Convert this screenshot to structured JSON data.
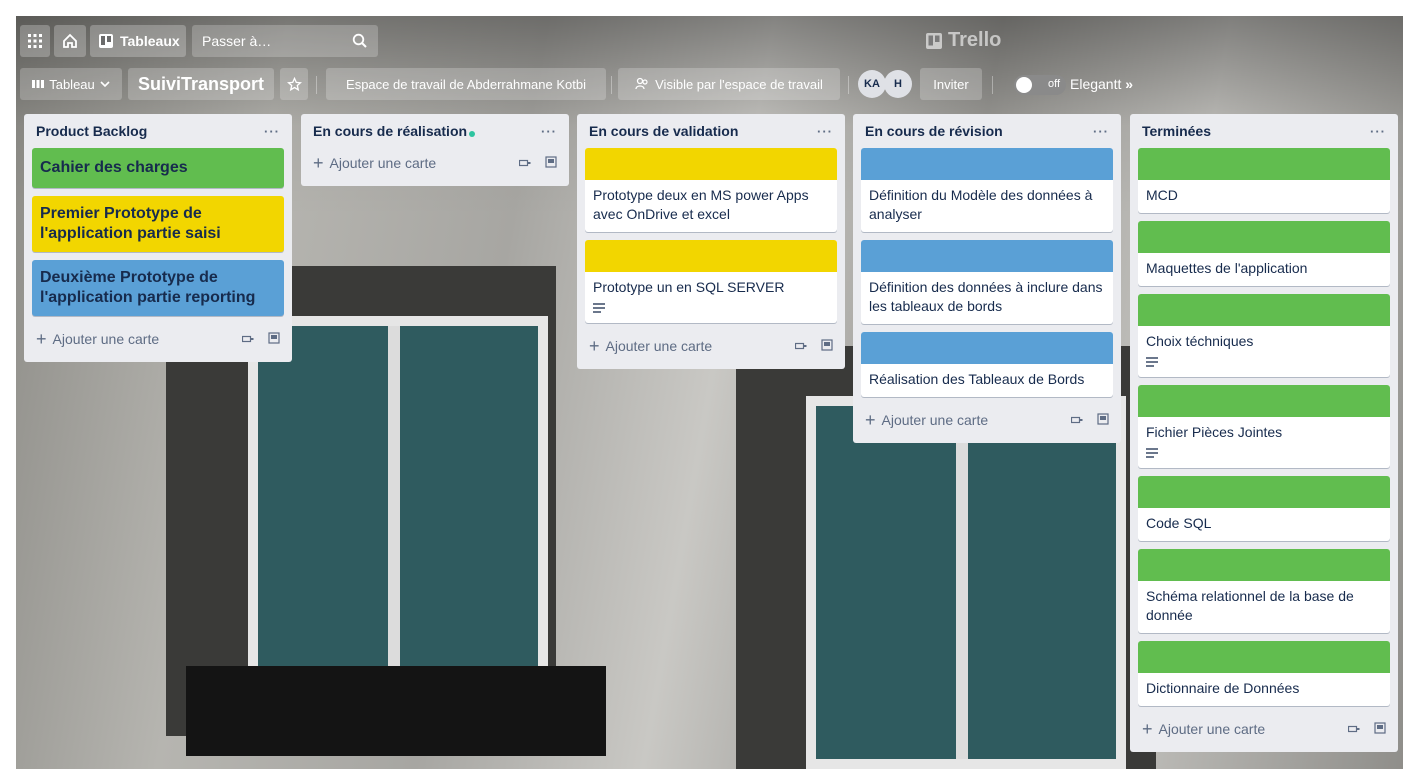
{
  "header": {
    "tableaux_label": "Tableaux",
    "search_placeholder": "Passer à…",
    "logo_text": "Trello"
  },
  "board": {
    "view_label": "Tableau",
    "name": "SuiviTransport",
    "workspace_label": "Espace de travail de Abderrahmane Kotbi",
    "visibility_label": "Visible par l'espace de travail",
    "members": [
      "KA",
      "H"
    ],
    "invite_label": "Inviter",
    "toggle_label": "off",
    "elegantt_label": "Elegantt",
    "elegantt_suffix": "»"
  },
  "add_card_label": "Ajouter une carte",
  "colors": {
    "green": "#61bd4f",
    "yellow": "#f2d600",
    "blue": "#5aa0d6"
  },
  "lists": [
    {
      "title": "Product Backlog",
      "cards": [
        {
          "title": "Cahier des charges",
          "color": "green",
          "style": "full"
        },
        {
          "title": "Premier Prototype de l'application partie saisi",
          "color": "yellow",
          "style": "full"
        },
        {
          "title": "Deuxième Prototype de l'application partie reporting",
          "color": "blue",
          "style": "full"
        }
      ]
    },
    {
      "title": "En cours de réalisation",
      "cards": []
    },
    {
      "title": "En cours de validation",
      "cards": [
        {
          "title": "Prototype deux en MS power Apps avec OnDrive et excel",
          "color": "yellow",
          "style": "cover"
        },
        {
          "title": "Prototype un en SQL SERVER",
          "color": "yellow",
          "style": "cover",
          "has_description": true
        }
      ]
    },
    {
      "title": "En cours de révision",
      "cards": [
        {
          "title": "Définition du Modèle des données à analyser",
          "color": "blue",
          "style": "cover"
        },
        {
          "title": "Définition des données à inclure dans les tableaux de bords",
          "color": "blue",
          "style": "cover"
        },
        {
          "title": "Réalisation des Tableaux de Bords",
          "color": "blue",
          "style": "cover"
        }
      ]
    },
    {
      "title": "Terminées",
      "cards": [
        {
          "title": "MCD",
          "color": "green",
          "style": "cover"
        },
        {
          "title": "Maquettes de l'application",
          "color": "green",
          "style": "cover"
        },
        {
          "title": "Choix téchniques",
          "color": "green",
          "style": "cover",
          "has_description": true
        },
        {
          "title": "Fichier Pièces Jointes",
          "color": "green",
          "style": "cover",
          "has_description": true
        },
        {
          "title": "Code SQL",
          "color": "green",
          "style": "cover"
        },
        {
          "title": "Schéma relationnel de la base de donnée",
          "color": "green",
          "style": "cover"
        },
        {
          "title": "Dictionnaire de Données",
          "color": "green",
          "style": "cover"
        }
      ]
    }
  ]
}
